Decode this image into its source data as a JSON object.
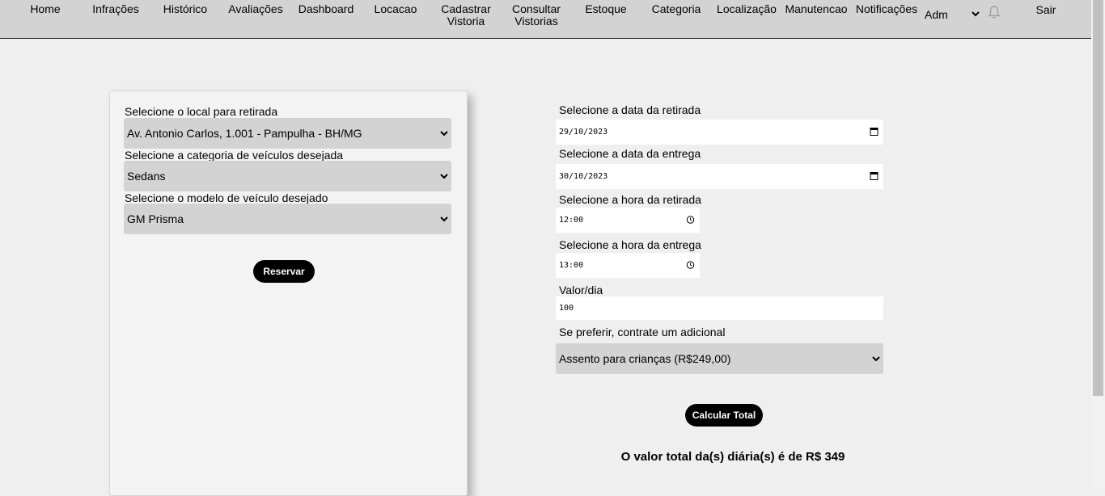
{
  "nav": {
    "items": [
      {
        "label": "Home"
      },
      {
        "label": "Infrações"
      },
      {
        "label": "Histórico"
      },
      {
        "label": "Avaliações"
      },
      {
        "label": "Dashboard"
      },
      {
        "label": "Locacao"
      },
      {
        "label": "Cadastrar Vistoria"
      },
      {
        "label": "Consultar Vistorias"
      },
      {
        "label": "Estoque"
      },
      {
        "label": "Categoria"
      },
      {
        "label": "Localização"
      },
      {
        "label": "Manutencao"
      },
      {
        "label": "Notificações"
      }
    ],
    "user": "Adm",
    "logout": "Sair"
  },
  "left": {
    "location_label": "Selecione o local para retirada",
    "location_value": "Av. Antonio Carlos, 1.001 - Pampulha - BH/MG",
    "category_label": "Selecione a categoria de veículos desejada",
    "category_value": "Sedans",
    "model_label": "Selecione o modelo de veículo desejado",
    "model_value": "GM Prisma",
    "reserve_button": "Reservar"
  },
  "right": {
    "pickup_date_label": "Selecione a data da retirada",
    "pickup_date_value": "29/10/2023",
    "return_date_label": "Selecione a data da entrega",
    "return_date_value": "30/10/2023",
    "pickup_time_label": "Selecione a hora da retirada",
    "pickup_time_value": "12:00",
    "return_time_label": "Selecione a hora da entrega",
    "return_time_value": "13:00",
    "rate_label": "Valor/dia",
    "rate_value": "100",
    "addon_label": "Se preferir, contrate um adicional",
    "addon_value": "Assento para crianças (R$249,00)",
    "calc_button": "Calcular Total",
    "total_text": "O valor total da(s) diária(s) é de R$ 349"
  }
}
